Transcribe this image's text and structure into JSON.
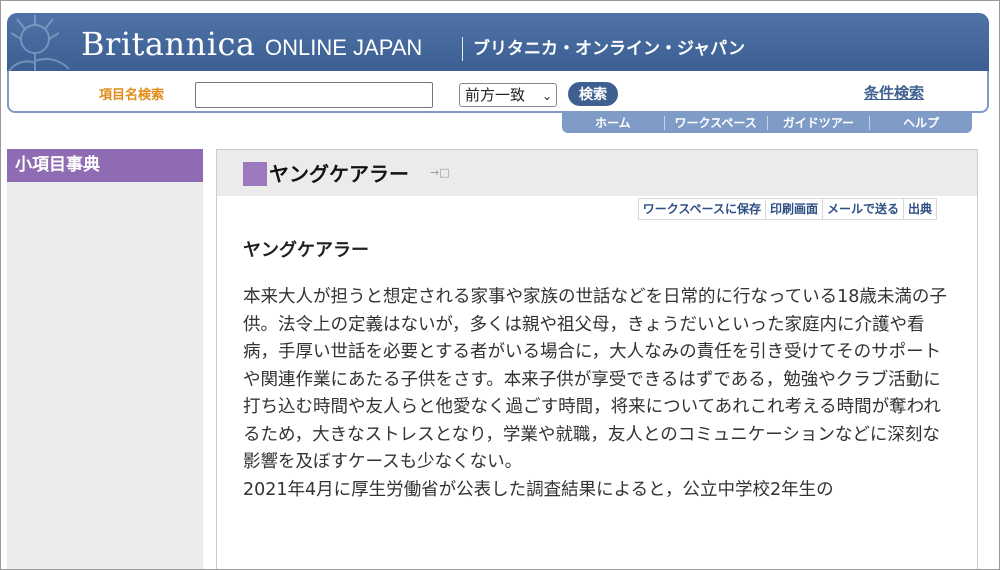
{
  "header": {
    "brand": "Britannica",
    "brand_sub": "ONLINE JAPAN",
    "brand_kana": "ブリタニカ・オンライン・ジャパン"
  },
  "search": {
    "label": "項目名検索",
    "input_value": "",
    "match_selected": "前方一致",
    "button_label": "検索",
    "advanced_label": "条件検索"
  },
  "nav": {
    "tabs": [
      "ホーム",
      "ワークスペース",
      "ガイドツアー",
      "ヘルプ"
    ]
  },
  "sidebar": {
    "title": "小項目事典"
  },
  "entry": {
    "title": "ヤングケアラー",
    "actions": [
      "ワークスペースに保存",
      "印刷画面",
      "メールで送る",
      "出典"
    ],
    "heading": "ヤングケアラー",
    "paragraphs": [
      "本来大人が担うと想定される家事や家族の世話などを日常的に行なっている18歳未満の子供。法令上の定義はないが，多くは親や祖父母，きょうだいといった家庭内に介護や看病，手厚い世話を必要とする者がいる場合に，大人なみの責任を引き受けてそのサポートや関連作業にあたる子供をさす。本来子供が享受できるはずである，勉強やクラブ活動に打ち込む時間や友人らと他愛なく過ごす時間，将来についてあれこれ考える時間が奪われるため，大きなストレスとなり，学業や就職，友人とのコミュニケーションなどに深刻な影響を及ぼすケースも少なくない。",
      "2021年4月に厚生労働省が公表した調査結果によると，公立中学校2年生の"
    ]
  },
  "colors": {
    "banner": "#3b5f93",
    "accent_orange": "#e08c1a",
    "sidebar_purple": "#8e6bb2",
    "marker_purple": "#9c78bf"
  }
}
